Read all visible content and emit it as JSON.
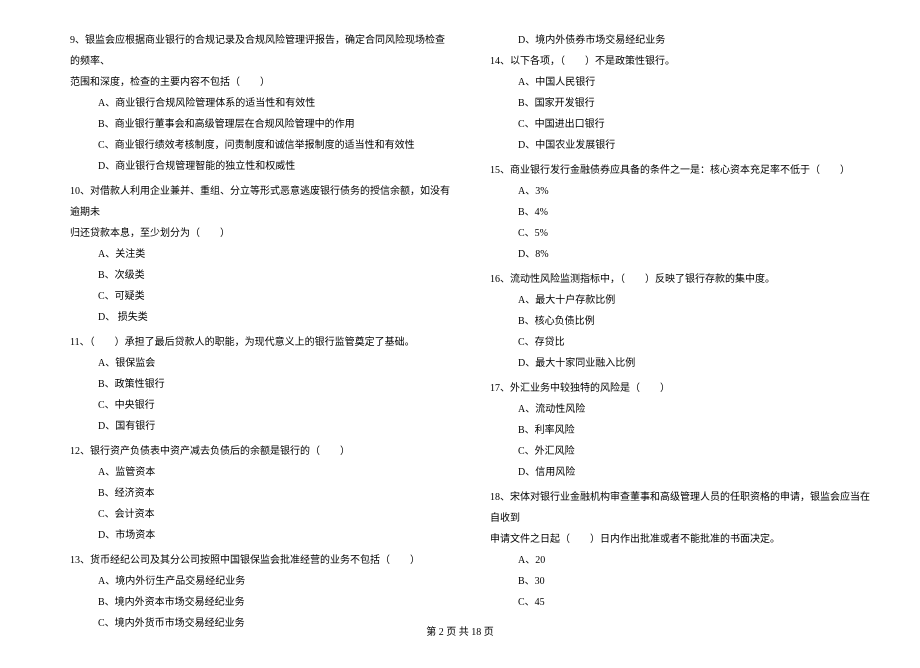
{
  "left": {
    "q9": {
      "line1": "9、银监会应根据商业银行的合规记录及合规风险管理评报告，确定合同风险现场检查的频率、",
      "line2": "范围和深度，检查的主要内容不包括（　　）",
      "a": "A、商业银行合规风险管理体系的适当性和有效性",
      "b": "B、商业银行董事会和高级管理层在合规风险管理中的作用",
      "c": "C、商业银行绩效考核制度，问责制度和诚信举报制度的适当性和有效性",
      "d": "D、商业银行合规管理智能的独立性和权威性"
    },
    "q10": {
      "line1": "10、对借款人利用企业兼并、重组、分立等形式恶意逃废银行债务的授信余额，如没有逾期未",
      "line2": "归还贷款本息，至少划分为（　　）",
      "a": "A、关注类",
      "b": "B、次级类",
      "c": "C、可疑类",
      "d": "D、 损失类"
    },
    "q11": {
      "text": "11、（　　）承担了最后贷款人的职能，为现代意义上的银行监管奠定了基础。",
      "a": "A、银保监会",
      "b": "B、政策性银行",
      "c": "C、中央银行",
      "d": "D、国有银行"
    },
    "q12": {
      "text": "12、银行资产负债表中资产减去负债后的余额是银行的（　　）",
      "a": "A、监管资本",
      "b": "B、经济资本",
      "c": "C、会计资本",
      "d": "D、市场资本"
    },
    "q13": {
      "text": "13、货币经纪公司及其分公司按照中国银保监会批准经营的业务不包括（　　）",
      "a": "A、境内外衍生产品交易经纪业务",
      "b": "B、境内外资本市场交易经纪业务",
      "c": "C、境内外货币市场交易经纪业务"
    }
  },
  "right": {
    "q13d": "D、境内外债券市场交易经纪业务",
    "q14": {
      "text": "14、以下各项，（　　）不是政策性银行。",
      "a": "A、中国人民银行",
      "b": "B、国家开发银行",
      "c": "C、中国进出口银行",
      "d": "D、中国农业发展银行"
    },
    "q15": {
      "text": "15、商业银行发行金融债券应具备的条件之一是：核心资本充足率不低于（　　）",
      "a": "A、3%",
      "b": "B、4%",
      "c": "C、5%",
      "d": "D、8%"
    },
    "q16": {
      "text": "16、流动性风险监测指标中，（　　）反映了银行存款的集中度。",
      "a": "A、最大十户存款比例",
      "b": "B、核心负债比例",
      "c": "C、存贷比",
      "d": "D、最大十家同业融入比例"
    },
    "q17": {
      "text": "17、外汇业务中较独特的风险是（　　）",
      "a": "A、流动性风险",
      "b": "B、利率风险",
      "c": "C、外汇风险",
      "d": "D、信用风险"
    },
    "q18": {
      "line1": "18、宋体对银行业金融机构审查董事和高级管理人员的任职资格的申请，银监会应当在自收到",
      "line2": "申请文件之日起（　　）日内作出批准或者不能批准的书面决定。",
      "a": "A、20",
      "b": "B、30",
      "c": "C、45"
    }
  },
  "footer": "第 2 页 共 18 页"
}
